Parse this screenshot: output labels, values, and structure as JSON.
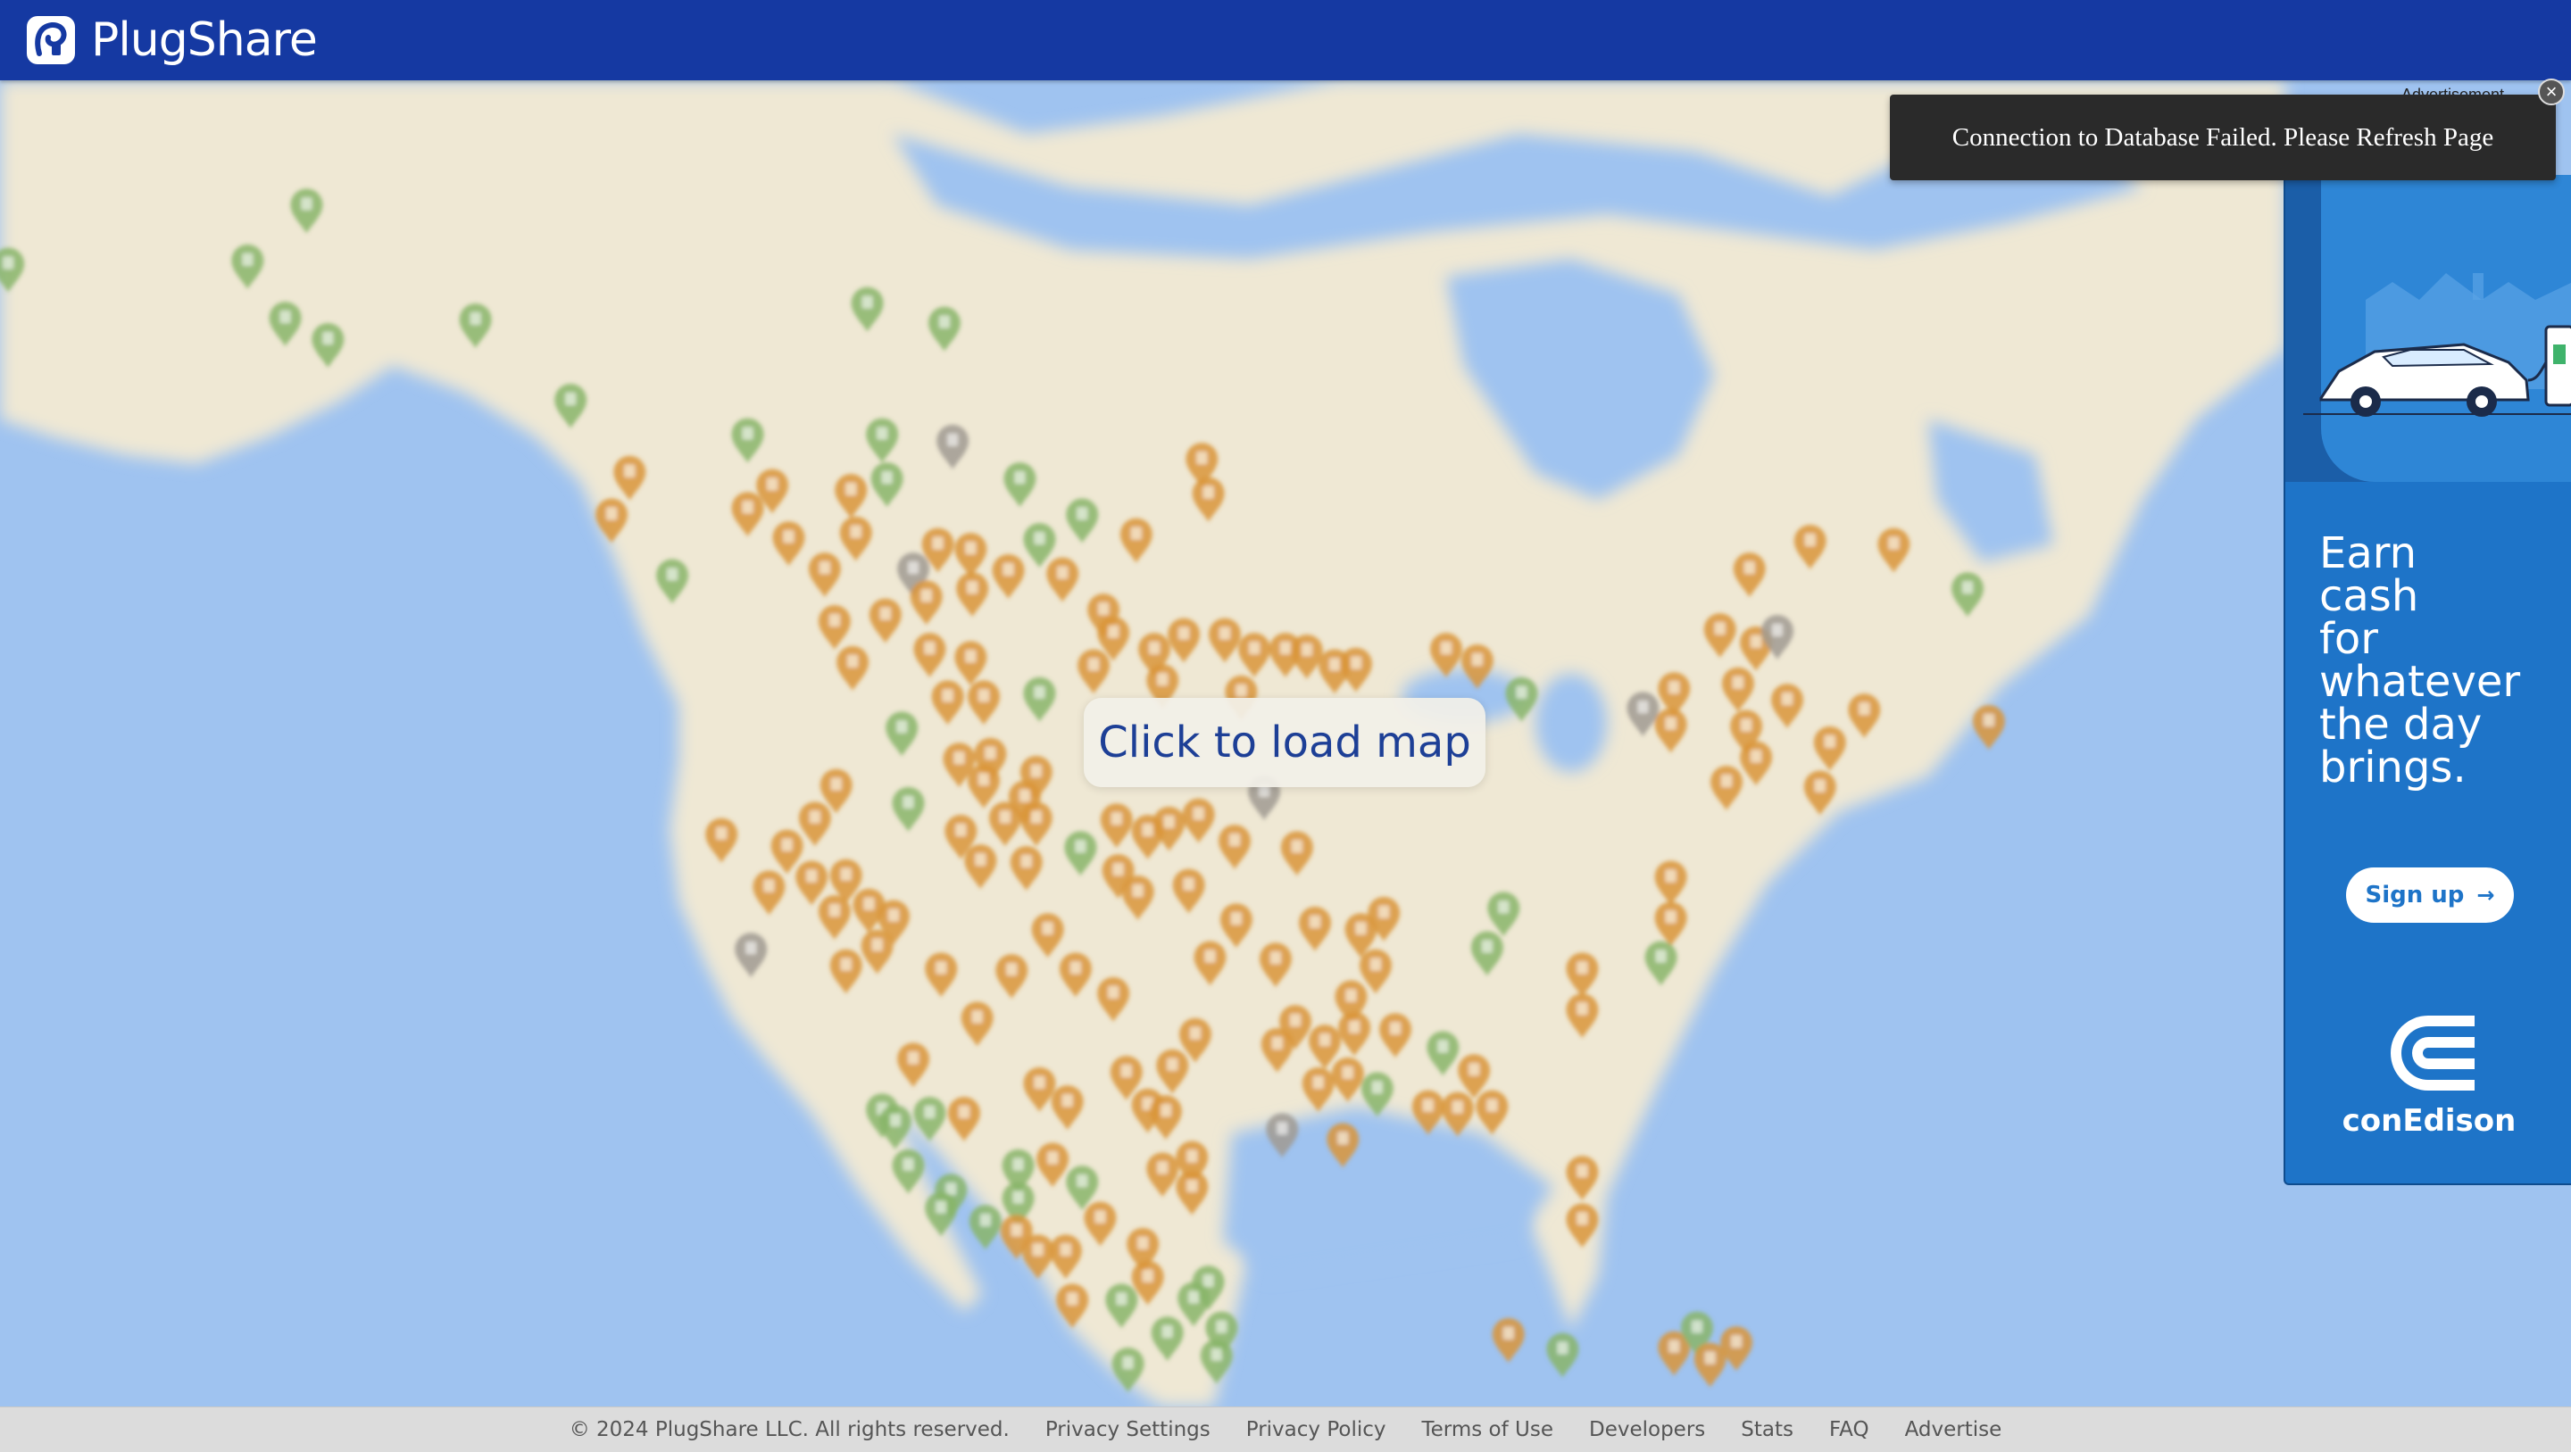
{
  "header": {
    "brand": "PlugShare"
  },
  "map": {
    "load_button_label": "Click to load map"
  },
  "notification": {
    "message": "Connection to Database Failed. Please Refresh Page"
  },
  "ad": {
    "label": "Advertisement",
    "close_glyph": "×",
    "headline": "Earn\ncash\nfor\nwhatever\nthe day\nbrings.",
    "cta": "Sign up",
    "cta_arrow": "→",
    "brand": "conEdison",
    "accent": "#1e74c8"
  },
  "footer": {
    "copyright": "© 2024 PlugShare LLC. All rights reserved.",
    "links": [
      "Privacy Settings",
      "Privacy Policy",
      "Terms of Use",
      "Developers",
      "Stats",
      "FAQ",
      "Advertise"
    ]
  },
  "colors": {
    "header": "#1539a2",
    "ocean": "#9fc3f0",
    "land": "#efe8d4",
    "pin_orange": "#d9953a",
    "pin_green": "#88b56a",
    "pin_gray": "#a09a92"
  }
}
